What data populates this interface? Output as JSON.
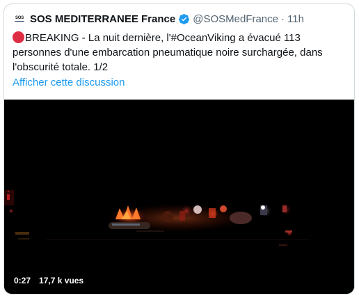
{
  "tweet": {
    "author_name": "SOS MEDITERRANEE France",
    "author_handle": "@SOSMedFrance",
    "separator": "·",
    "timestamp": "11h",
    "avatar_text": "SOS",
    "verified": true,
    "text": "BREAKING - La nuit dernière, l'#OceanViking a évacué 113 personnes d'une embarcation pneumatique noire surchargée, dans l'obscurité totale. 1/2",
    "emoji": "red-circle",
    "show_thread_label": "Afficher cette discussion"
  },
  "video": {
    "duration": "0:27",
    "views": "17,7 k vues"
  },
  "colors": {
    "link": "#1d9bf0",
    "secondary_text": "#536471",
    "border": "#cfd9de",
    "verified_badge": "#1d9bf0",
    "emoji_red": "#dd2e44",
    "video_background": "#000000"
  }
}
